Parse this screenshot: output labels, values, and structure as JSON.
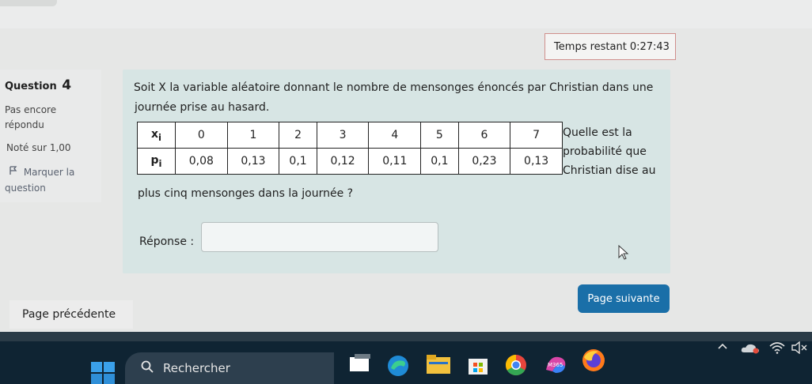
{
  "timer": {
    "label": "Temps restant",
    "value": "0:27:43"
  },
  "question_info": {
    "title": "Question",
    "number": "4",
    "status_line1": "Pas encore",
    "status_line2": "répondu",
    "grade": "Noté sur 1,00",
    "flag_line1": "Marquer la",
    "flag_line2": "question"
  },
  "question": {
    "line1": "Soit X la variable aléatoire donnant le nombre de mensonges énoncés par Christian dans une",
    "line2": "journée prise au hasard.",
    "side_line1": "Quelle est la",
    "side_line2": "probabilité que",
    "side_line3": "Christian dise au",
    "line3": "plus cinq mensonges dans la journée ?",
    "table": {
      "row1_header": "xi",
      "row2_header": "pi",
      "x_values": [
        "0",
        "1",
        "2",
        "3",
        "4",
        "5",
        "6",
        "7"
      ],
      "p_values": [
        "0,08",
        "0,13",
        "0,1",
        "0,12",
        "0,11",
        "0,1",
        "0,23",
        "0,13"
      ]
    }
  },
  "answer": {
    "label": "Réponse :",
    "value": ""
  },
  "nav": {
    "prev_label": "Page précédente",
    "next_label": "Page suivante"
  },
  "taskbar": {
    "search_label": "Rechercher",
    "m365_label": "M365"
  },
  "colors": {
    "panel": "#d7e5e4",
    "accent": "#1a6fa8",
    "taskbar": "#0f2433",
    "timer_border": "#d08f8c"
  }
}
